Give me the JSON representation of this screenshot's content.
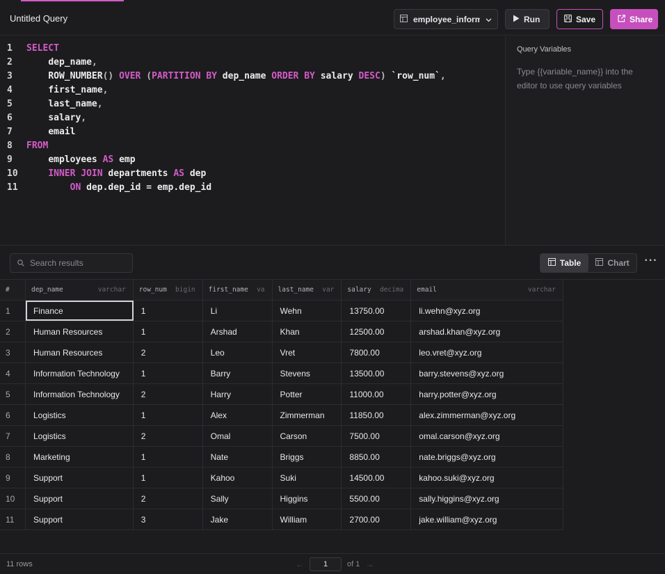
{
  "header": {
    "title": "Untitled Query",
    "database": "employee_inform...",
    "run_label": "Run",
    "save_label": "Save",
    "share_label": "Share"
  },
  "editor": {
    "lines": [
      {
        "n": "1",
        "indent": "",
        "tokens": [
          {
            "t": "SELECT",
            "k": "kw"
          }
        ]
      },
      {
        "n": "2",
        "indent": "    ",
        "tokens": [
          {
            "t": "dep_name",
            "k": ""
          },
          {
            "t": ",",
            "k": "pn"
          }
        ]
      },
      {
        "n": "3",
        "indent": "    ",
        "tokens": [
          {
            "t": "ROW_NUMBER",
            "k": ""
          },
          {
            "t": "()",
            "k": "pn"
          },
          {
            "t": " OVER ",
            "k": "kw"
          },
          {
            "t": "(",
            "k": "pn"
          },
          {
            "t": "PARTITION BY",
            "k": "kw"
          },
          {
            "t": " dep_name ",
            "k": ""
          },
          {
            "t": "ORDER BY",
            "k": "kw"
          },
          {
            "t": " salary ",
            "k": ""
          },
          {
            "t": "DESC",
            "k": "kw"
          },
          {
            "t": ") ",
            "k": "pn"
          },
          {
            "t": "`row_num`",
            "k": ""
          },
          {
            "t": ",",
            "k": "pn"
          }
        ]
      },
      {
        "n": "4",
        "indent": "    ",
        "tokens": [
          {
            "t": "first_name",
            "k": ""
          },
          {
            "t": ",",
            "k": "pn"
          }
        ]
      },
      {
        "n": "5",
        "indent": "    ",
        "tokens": [
          {
            "t": "last_name",
            "k": ""
          },
          {
            "t": ",",
            "k": "pn"
          }
        ]
      },
      {
        "n": "6",
        "indent": "    ",
        "tokens": [
          {
            "t": "salary",
            "k": ""
          },
          {
            "t": ",",
            "k": "pn"
          }
        ]
      },
      {
        "n": "7",
        "indent": "    ",
        "tokens": [
          {
            "t": "email",
            "k": ""
          }
        ]
      },
      {
        "n": "8",
        "indent": "",
        "tokens": [
          {
            "t": "FROM",
            "k": "kw"
          }
        ]
      },
      {
        "n": "9",
        "indent": "    ",
        "tokens": [
          {
            "t": "employees ",
            "k": ""
          },
          {
            "t": "AS",
            "k": "kw"
          },
          {
            "t": " emp",
            "k": ""
          }
        ]
      },
      {
        "n": "10",
        "indent": "    ",
        "tokens": [
          {
            "t": "INNER JOIN",
            "k": "kw"
          },
          {
            "t": " departments ",
            "k": ""
          },
          {
            "t": "AS",
            "k": "kw"
          },
          {
            "t": " dep",
            "k": ""
          }
        ]
      },
      {
        "n": "11",
        "indent": "        ",
        "tokens": [
          {
            "t": "ON",
            "k": "kw"
          },
          {
            "t": " dep.dep_id = emp.dep_id",
            "k": ""
          }
        ]
      }
    ]
  },
  "variables": {
    "title": "Query Variables",
    "hint": "Type {{variable_name}} into the editor to use query variables"
  },
  "results": {
    "search_placeholder": "Search results",
    "table_label": "Table",
    "chart_label": "Chart",
    "columns": [
      {
        "name": "#",
        "type": ""
      },
      {
        "name": "dep_name",
        "type": "varchar"
      },
      {
        "name": "row_num",
        "type": "bigin"
      },
      {
        "name": "first_name",
        "type": "va"
      },
      {
        "name": "last_name",
        "type": "var"
      },
      {
        "name": "salary",
        "type": "decima"
      },
      {
        "name": "email",
        "type": "varchar"
      }
    ],
    "rows": [
      [
        "1",
        "Finance",
        "1",
        "Li",
        "Wehn",
        "13750.00",
        "li.wehn@xyz.org"
      ],
      [
        "2",
        "Human Resources",
        "1",
        "Arshad",
        "Khan",
        "12500.00",
        "arshad.khan@xyz.org"
      ],
      [
        "3",
        "Human Resources",
        "2",
        "Leo",
        "Vret",
        "7800.00",
        "leo.vret@xyz.org"
      ],
      [
        "4",
        "Information Technology",
        "1",
        "Barry",
        "Stevens",
        "13500.00",
        "barry.stevens@xyz.org"
      ],
      [
        "5",
        "Information Technology",
        "2",
        "Harry",
        "Potter",
        "11000.00",
        "harry.potter@xyz.org"
      ],
      [
        "6",
        "Logistics",
        "1",
        "Alex",
        "Zimmerman",
        "11850.00",
        "alex.zimmerman@xyz.org"
      ],
      [
        "7",
        "Logistics",
        "2",
        "Omal",
        "Carson",
        "7500.00",
        "omal.carson@xyz.org"
      ],
      [
        "8",
        "Marketing",
        "1",
        "Nate",
        "Briggs",
        "8850.00",
        "nate.briggs@xyz.org"
      ],
      [
        "9",
        "Support",
        "1",
        "Kahoo",
        "Suki",
        "14500.00",
        "kahoo.suki@xyz.org"
      ],
      [
        "10",
        "Support",
        "2",
        "Sally",
        "Higgins",
        "5500.00",
        "sally.higgins@xyz.org"
      ],
      [
        "11",
        "Support",
        "3",
        "Jake",
        "William",
        "2700.00",
        "jake.william@xyz.org"
      ]
    ]
  },
  "footer": {
    "rows_count": "11 rows",
    "page": "1",
    "of_pages": "of 1"
  },
  "colors": {
    "accent": "#c64fbd",
    "keyword": "#d45bc8",
    "background": "#1c1c1e"
  },
  "icons": [
    "table-icon",
    "play-icon",
    "save-icon",
    "share-icon",
    "chevron-down-icon",
    "search-icon",
    "chart-icon",
    "more-icon",
    "arrow-left-icon",
    "arrow-right-icon"
  ]
}
